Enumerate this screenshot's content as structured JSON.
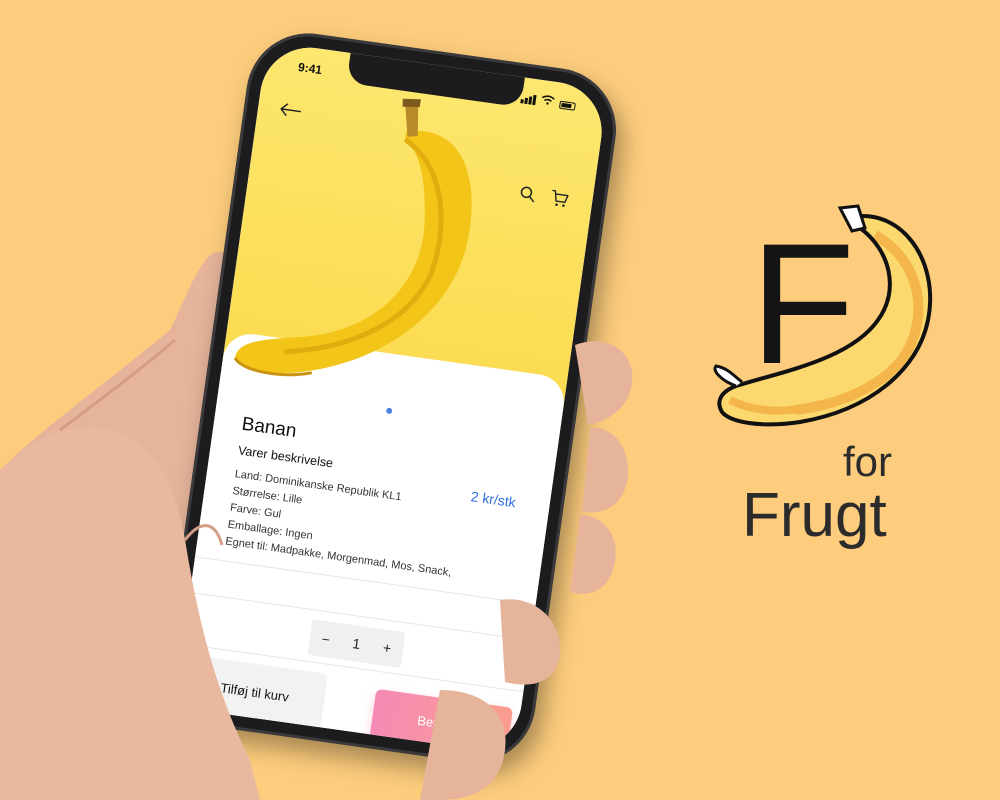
{
  "status_bar": {
    "time": "9:41"
  },
  "nav": {
    "back_icon": "arrow-left-icon",
    "search_icon": "search-icon",
    "cart_icon": "cart-icon"
  },
  "product": {
    "name": "Banan",
    "description_title": "Varer beskrivelse",
    "price": "2 kr/stk",
    "details": [
      "Land: Dominikanske Republik KL1",
      "Størrelse: Lille",
      "Farve: Gul",
      "Emballage: Ingen",
      "Egnet til: Madpakke, Morgenmad, Mos, Snack,"
    ]
  },
  "quantity": {
    "minus": "−",
    "value": "1",
    "plus": "+"
  },
  "actions": {
    "add_to_cart": "Tilføj til kurv",
    "pay_now": "Betal nu"
  },
  "logo": {
    "letter": "F",
    "for": "for",
    "word": "Frugt"
  },
  "colors": {
    "background": "#fdcd7d",
    "price": "#2f6fe0",
    "pay_gradient_start": "#f58ab6",
    "pay_gradient_end": "#fb9d8d",
    "indicator": "#4f7fe3"
  }
}
